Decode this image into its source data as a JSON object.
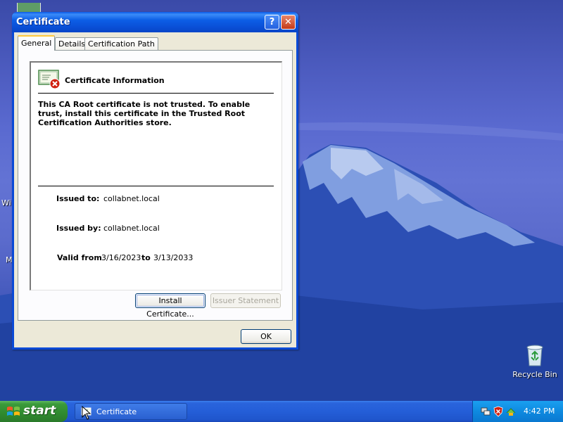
{
  "desktop": {
    "icons": {
      "partial_left_1": "Wi",
      "partial_left_2": "M",
      "recycle_bin": "Recycle Bin"
    }
  },
  "window": {
    "title": "Certificate",
    "help_icon": "?",
    "close_icon": "✕",
    "tabs": [
      {
        "label": "General",
        "active": true
      },
      {
        "label": "Details",
        "active": false
      },
      {
        "label": "Certification Path",
        "active": false
      }
    ],
    "info": {
      "title": "Certificate Information",
      "warning": "This CA Root certificate is not trusted. To enable trust, install this certificate in the Trusted Root Certification Authorities store.",
      "issued_to_label": "Issued to:",
      "issued_to_value": "collabnet.local",
      "issued_by_label": "Issued by:",
      "issued_by_value": "collabnet.local",
      "valid_from_label": "Valid from",
      "valid_from_value": "3/16/2023",
      "valid_to_label": "to",
      "valid_to_value": "3/13/2033"
    },
    "buttons": {
      "install": "Install Certificate...",
      "issuer": "Issuer Statement",
      "ok": "OK"
    }
  },
  "taskbar": {
    "start_label": "start",
    "task_button": "Certificate",
    "clock": "4:42 PM"
  },
  "colors": {
    "titlebar": "#0a5ae8",
    "taskbar": "#245ed8",
    "start": "#3a9a3a",
    "tab_highlight": "#ffc83c",
    "dialog_bg": "#ece9d8"
  }
}
